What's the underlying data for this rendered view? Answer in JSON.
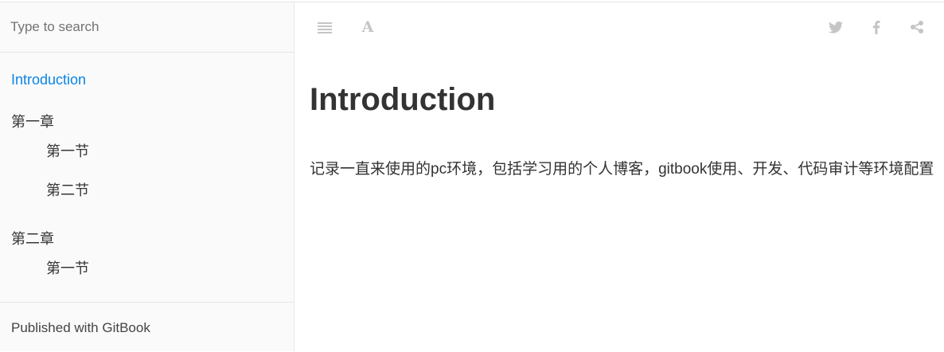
{
  "search": {
    "placeholder": "Type to search"
  },
  "sidebar": {
    "items": [
      {
        "label": "Introduction",
        "level": 0,
        "active": true
      },
      {
        "label": "第一章",
        "level": 0,
        "active": false
      },
      {
        "label": "第一节",
        "level": 1,
        "active": false
      },
      {
        "label": "第二节",
        "level": 1,
        "active": false
      },
      {
        "label": "第二章",
        "level": 0,
        "active": false
      },
      {
        "label": "第一节",
        "level": 1,
        "active": false
      }
    ],
    "footer_link": "Published with GitBook"
  },
  "toolbar": {
    "left_icons": [
      "sidebar-toggle-icon",
      "font-settings-icon"
    ],
    "right_icons": [
      "twitter-icon",
      "facebook-icon",
      "share-icon"
    ],
    "font_glyph": "A"
  },
  "page": {
    "title": "Introduction",
    "body": "记录一直来使用的pc环境，包括学习用的个人博客，gitbook使用、开发、代码审计等环境配置"
  },
  "colors": {
    "accent": "#0a84e6",
    "sidebar_bg": "#fafafa",
    "icon": "#c5c5c5",
    "text": "#333333"
  }
}
